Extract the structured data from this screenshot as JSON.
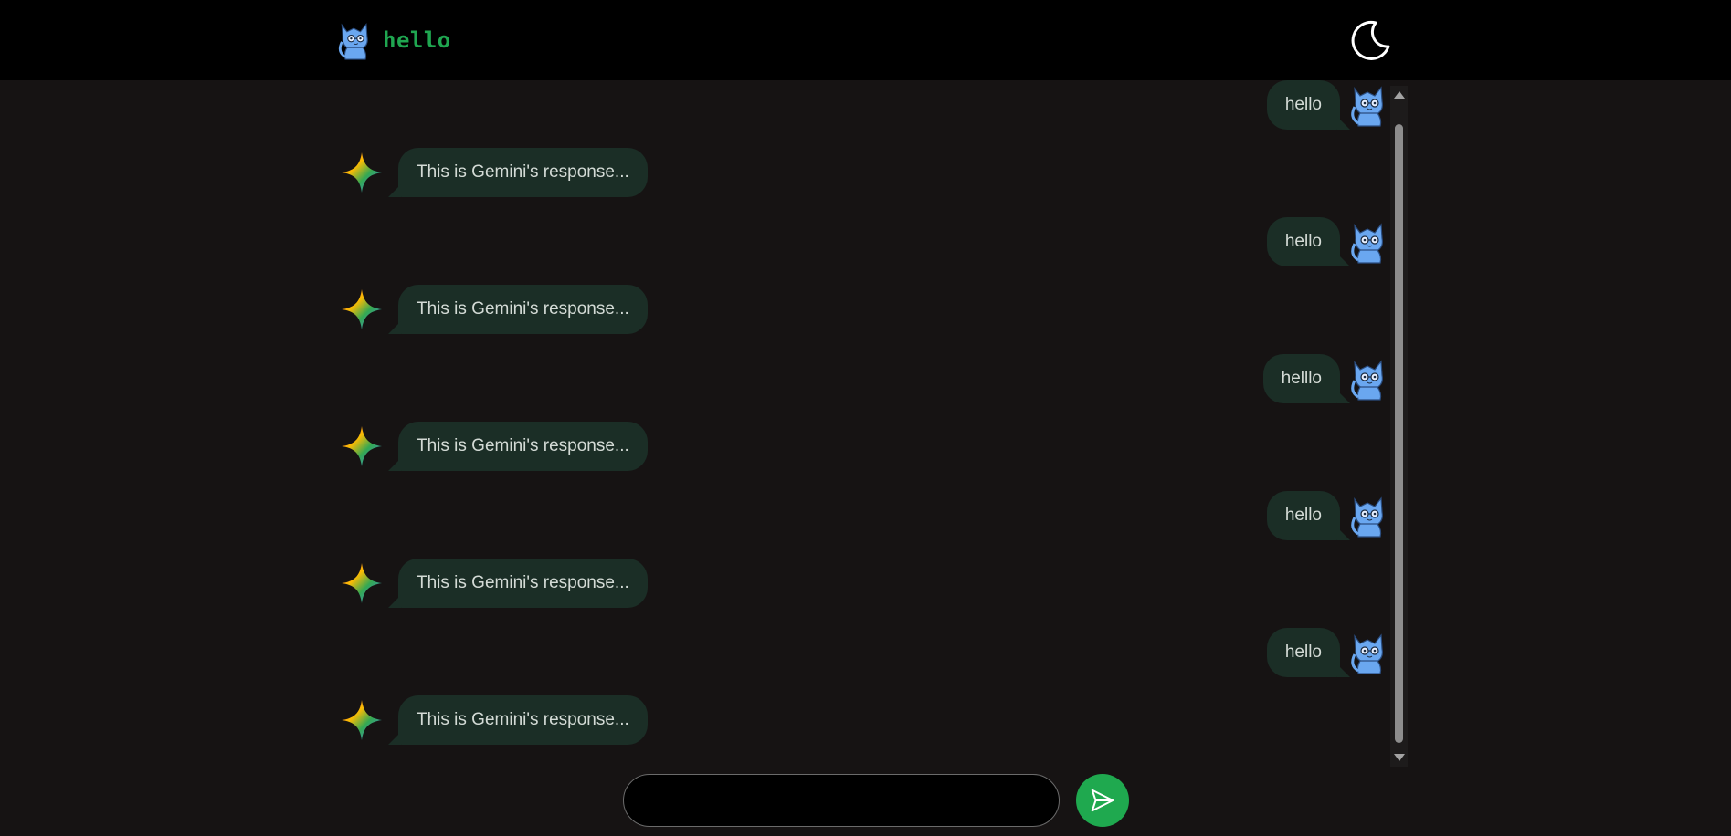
{
  "header": {
    "title": "hello",
    "logo_icon": "cat-avatar-icon",
    "theme_toggle_icon": "moon-icon"
  },
  "messages": [
    {
      "role": "user",
      "text": "hello"
    },
    {
      "role": "assistant",
      "text": "This is Gemini's response..."
    },
    {
      "role": "user",
      "text": "hello"
    },
    {
      "role": "assistant",
      "text": "This is Gemini's response..."
    },
    {
      "role": "user",
      "text": "helllo"
    },
    {
      "role": "assistant",
      "text": "This is Gemini's response..."
    },
    {
      "role": "user",
      "text": "hello"
    },
    {
      "role": "assistant",
      "text": "This is Gemini's response..."
    },
    {
      "role": "user",
      "text": "hello"
    },
    {
      "role": "assistant",
      "text": "This is Gemini's response..."
    }
  ],
  "composer": {
    "value": "",
    "placeholder": "",
    "send_icon": "send-icon"
  },
  "colors": {
    "header_bg": "#000000",
    "page_bg": "#161313",
    "bubble_bg": "#1b2e26",
    "accent": "#1fa94f",
    "avatar_blue": "#6aa7f0"
  }
}
